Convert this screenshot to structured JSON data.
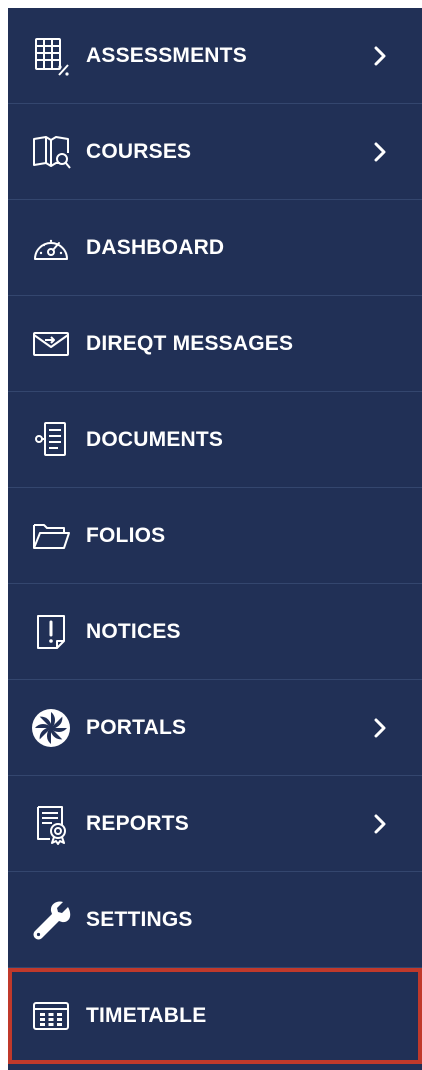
{
  "colors": {
    "background": "#213056",
    "divider": "#34466e",
    "text": "#ffffff",
    "highlight_border": "#c0392b"
  },
  "nav": {
    "items": [
      {
        "label": "ASSESSMENTS",
        "icon": "assessments-icon",
        "has_submenu": true
      },
      {
        "label": "COURSES",
        "icon": "courses-icon",
        "has_submenu": true
      },
      {
        "label": "DASHBOARD",
        "icon": "dashboard-gauge-icon",
        "has_submenu": false
      },
      {
        "label": "DIREQT MESSAGES",
        "icon": "message-envelope-icon",
        "has_submenu": false
      },
      {
        "label": "DOCUMENTS",
        "icon": "documents-icon",
        "has_submenu": false
      },
      {
        "label": "FOLIOS",
        "icon": "folder-icon",
        "has_submenu": false
      },
      {
        "label": "NOTICES",
        "icon": "notice-icon",
        "has_submenu": false
      },
      {
        "label": "PORTALS",
        "icon": "portals-icon",
        "has_submenu": true
      },
      {
        "label": "REPORTS",
        "icon": "reports-icon",
        "has_submenu": true
      },
      {
        "label": "SETTINGS",
        "icon": "wrench-icon",
        "has_submenu": false
      },
      {
        "label": "TIMETABLE",
        "icon": "timetable-icon",
        "has_submenu": false,
        "highlighted": true
      }
    ]
  }
}
